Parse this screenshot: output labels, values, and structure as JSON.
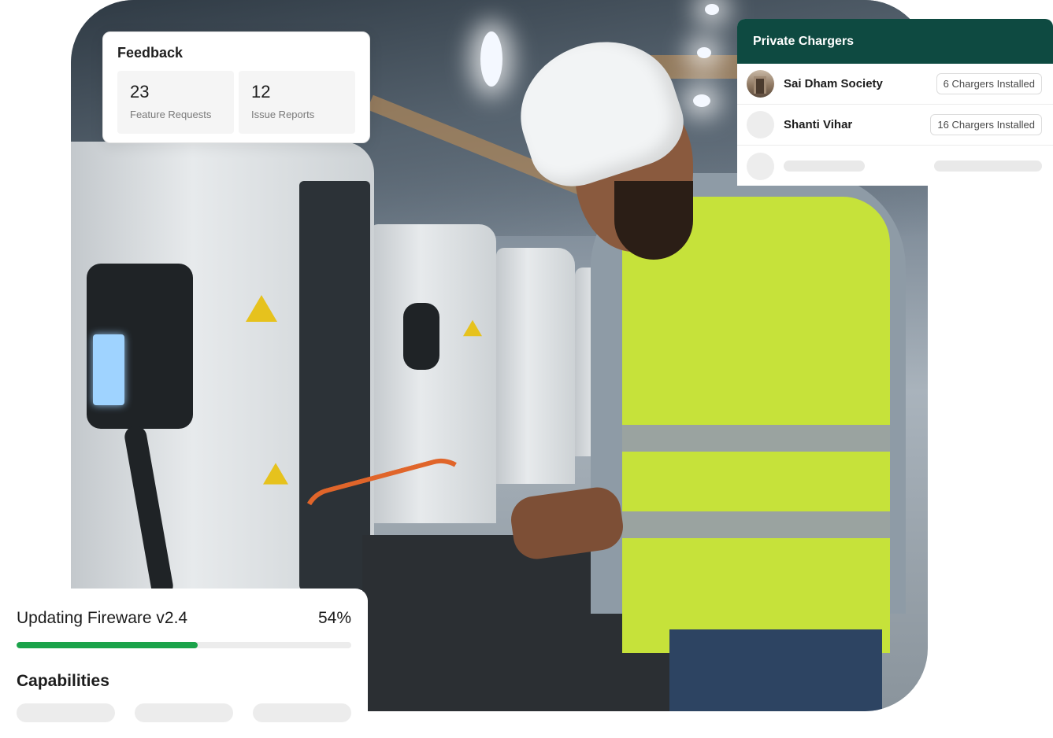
{
  "feedback": {
    "title": "Feedback",
    "stats": [
      {
        "value": "23",
        "label": "Feature Requests"
      },
      {
        "value": "12",
        "label": "Issue Reports"
      }
    ]
  },
  "private_chargers": {
    "title": "Private Chargers",
    "rows": [
      {
        "name": "Sai Dham Society",
        "badge": "6 Chargers Installed"
      },
      {
        "name": "Shanti Vihar",
        "badge": "16 Chargers Installed"
      }
    ]
  },
  "firmware": {
    "label": "Updating Fireware v2.4",
    "percent_text": "54%",
    "progress": 0.54
  },
  "capabilities": {
    "title": "Capabilities"
  },
  "colors": {
    "header_green": "#0e4a41",
    "progress_green": "#1ba34a"
  }
}
